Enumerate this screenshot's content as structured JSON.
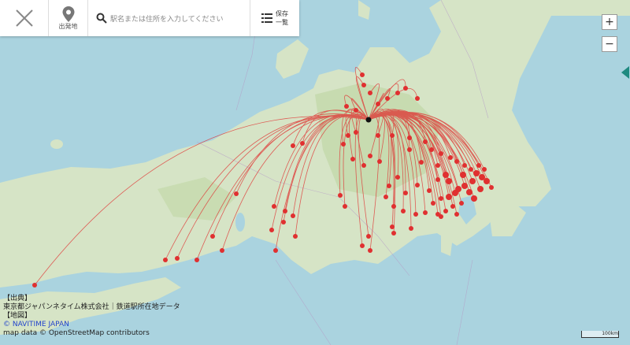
{
  "toolbar": {
    "close_icon": "close-x-icon",
    "pin_icon": "map-pin-icon",
    "pin_label": "出発地",
    "search_icon": "search-icon",
    "search_placeholder": "駅名または住所を入力してください",
    "list_icon": "list-icon",
    "save_label_line1": "保存",
    "save_label_line2": "一覧"
  },
  "zoom": {
    "in": "+",
    "out": "−"
  },
  "colors": {
    "route": "#e03030",
    "sea": "#aad3df",
    "land": "#d8e6c8",
    "mountain": "#c2d7a8"
  },
  "credits": {
    "line1": "【出典】",
    "line2": "東京都ジャパンネタイム株式会社｜鉄道駅所在地データ",
    "line3": "【地図】",
    "line4": "© NAVITIME JAPAN",
    "line5": "map data © OpenStreetMap contributors"
  },
  "scale": {
    "label": "100km"
  }
}
